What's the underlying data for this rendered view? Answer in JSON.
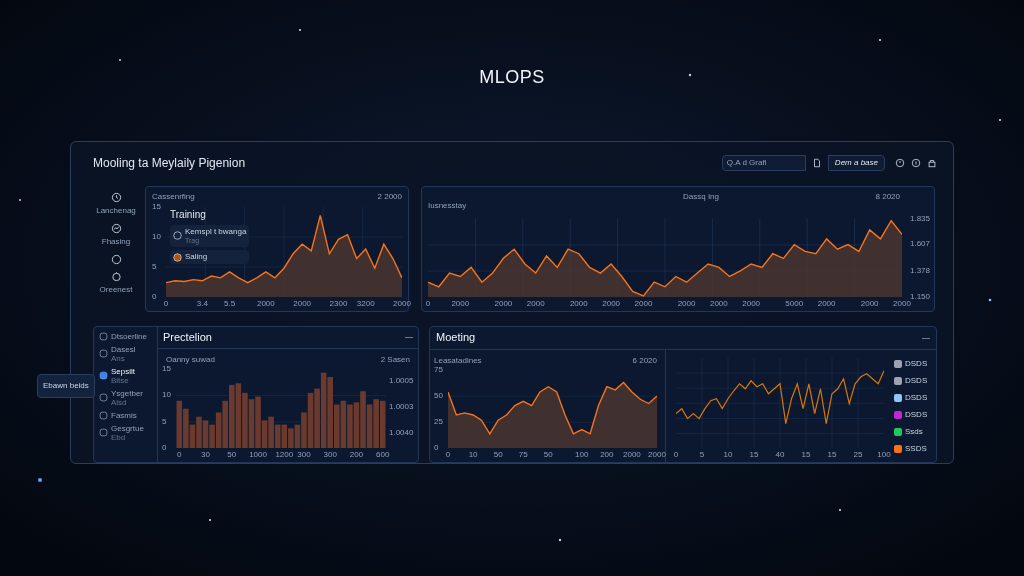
{
  "page_title": "MLOPS",
  "dashboard": {
    "title": "Mooling ta Meylaily Pigenion",
    "search": {
      "value": "Q.A d Grafi"
    },
    "button": "Dem a base"
  },
  "nav": [
    {
      "kind": "labeled",
      "label": "Lanchenag"
    },
    {
      "kind": "labeled",
      "label": "Fhasing"
    },
    {
      "kind": "icon"
    },
    {
      "kind": "labeled",
      "label": "Oreenest"
    }
  ],
  "training_panel": {
    "heading": "Cassenrfing",
    "reading": "2 2000",
    "title": "Training",
    "legend": [
      {
        "label": "Kemspl t bwanga",
        "sub": "Trag"
      },
      {
        "label": "Saling"
      }
    ],
    "chart_data": {
      "type": "area",
      "grid": true,
      "ylim": [
        0,
        15
      ],
      "yticks": [
        0,
        5,
        10,
        15
      ],
      "categories": [
        "0",
        null,
        null,
        null,
        "3.4",
        null,
        null,
        "5.5",
        null,
        null,
        null,
        "2000",
        null,
        null,
        null,
        "2000",
        null,
        null,
        null,
        "2300",
        null,
        null,
        "3200",
        null,
        null,
        null,
        "2000"
      ],
      "values": [
        2.4,
        2.7,
        2.6,
        2.9,
        2.7,
        3.5,
        3.2,
        4.2,
        3.2,
        2.4,
        3.2,
        4.2,
        3.2,
        4.8,
        7.2,
        8.8,
        7.7,
        13.6,
        7.2,
        9.6,
        10.4,
        6.4,
        8,
        4.8,
        8.8,
        6.4,
        3.2
      ]
    }
  },
  "trend_panel": {
    "left_heading": "Iusnesstay",
    "right_heading": "Dassq Ing",
    "reading": "8 2020",
    "chart_data": {
      "type": "area",
      "grid": true,
      "ylim": [
        1.15,
        1.835
      ],
      "yticks": [
        {
          "value": 1.15,
          "label": "1.150"
        },
        {
          "value": 1.378,
          "label": "1.378"
        },
        {
          "value": 1.607,
          "label": "1.607"
        },
        {
          "value": 1.835,
          "label": "1.835"
        }
      ],
      "categories": [
        "0",
        null,
        null,
        "2000",
        null,
        null,
        null,
        "2000",
        null,
        null,
        "2000",
        null,
        null,
        null,
        "2000",
        null,
        null,
        "2000",
        null,
        null,
        "2000",
        null,
        null,
        null,
        "2000",
        null,
        null,
        "2000",
        null,
        null,
        "2000",
        null,
        null,
        null,
        "5000",
        null,
        null,
        "2000",
        null,
        null,
        null,
        "2000",
        null,
        null,
        "2000"
      ],
      "values": [
        1.28,
        1.24,
        1.36,
        1.33,
        1.41,
        1.28,
        1.36,
        1.49,
        1.57,
        1.44,
        1.36,
        1.51,
        1.41,
        1.57,
        1.53,
        1.41,
        1.36,
        1.44,
        1.33,
        1.2,
        1.16,
        1.28,
        1.24,
        1.33,
        1.28,
        1.36,
        1.44,
        1.41,
        1.33,
        1.38,
        1.44,
        1.41,
        1.53,
        1.49,
        1.61,
        1.55,
        1.53,
        1.66,
        1.57,
        1.61,
        1.55,
        1.74,
        1.66,
        1.82,
        1.7
      ]
    }
  },
  "prediction": {
    "title": "Prectelion",
    "minimize": "—",
    "menu": [
      {
        "label": "Dtsoerline",
        "selected": false
      },
      {
        "label": "Dasesl",
        "sub": "Ans",
        "selected": false
      },
      {
        "label": "Sepsilt",
        "sub": "Bitse",
        "selected": true
      },
      {
        "label": "Ysgetber",
        "sub": "Alsd",
        "selected": false
      },
      {
        "label": "Fasmis",
        "selected": false
      },
      {
        "label": "Gesgrtue",
        "sub": "Ebd",
        "selected": false
      }
    ],
    "tooltip": "Ebawn beids",
    "heading": "Oanny suwad",
    "reading": "2 Sasen",
    "right_ticks": [
      "1.0005",
      "1.0003",
      "1.0040"
    ],
    "chart_data": {
      "type": "bar",
      "grid": true,
      "ylim": [
        0,
        15
      ],
      "yticks": [
        0,
        5,
        10,
        15
      ],
      "categories": [
        "0",
        null,
        null,
        null,
        "30",
        null,
        null,
        null,
        "50",
        null,
        null,
        null,
        "1000",
        null,
        null,
        null,
        "1200",
        null,
        null,
        "300",
        null,
        null,
        null,
        "300",
        null,
        null,
        null,
        "200",
        null,
        null,
        null,
        "600"
      ],
      "values": [
        9,
        7.5,
        4.5,
        6,
        5.3,
        4.5,
        6.8,
        9,
        12,
        12.3,
        10.5,
        9.3,
        9.8,
        5.3,
        6,
        4.5,
        4.5,
        3.8,
        4.5,
        6.8,
        10.5,
        11.3,
        14.3,
        13.5,
        8.3,
        9,
        8.3,
        8.7,
        10.8,
        8.3,
        9.3,
        9
      ]
    }
  },
  "modeling": {
    "title": "Moeting",
    "minimize": "—",
    "area_panel": {
      "heading": "Leasatadines",
      "reading": "6 2020",
      "chart_data": {
        "type": "area",
        "grid": true,
        "ylim": [
          0,
          75
        ],
        "yticks": [
          0,
          25,
          50,
          75
        ],
        "categories": [
          "0",
          null,
          null,
          "10",
          null,
          null,
          "50",
          null,
          null,
          "75",
          null,
          null,
          "50",
          null,
          null,
          null,
          "100",
          null,
          null,
          "200",
          null,
          null,
          "2000",
          null,
          null,
          "2000"
        ],
        "values": [
          54,
          32,
          34,
          32,
          27,
          14,
          27,
          32,
          41,
          45,
          41,
          54,
          59,
          54,
          32,
          14,
          18,
          14,
          41,
          59,
          56,
          63,
          54,
          47,
          43,
          50
        ]
      }
    },
    "line_panel": {
      "axis_labels": [
        "0",
        "5",
        "10",
        "15",
        "40",
        "15",
        "15",
        "25",
        "100"
      ]
    },
    "legend": [
      {
        "label": "DSDS",
        "color": "#9ca3af"
      },
      {
        "label": "DSDS",
        "color": "#9ca3af"
      },
      {
        "label": "DSDS",
        "color": "#93c5fd"
      },
      {
        "label": "DSDS",
        "color": "#c026d3"
      },
      {
        "label": "Ssds",
        "color": "#22c55e"
      },
      {
        "label": "SSDS",
        "color": "#f97316"
      }
    ]
  }
}
